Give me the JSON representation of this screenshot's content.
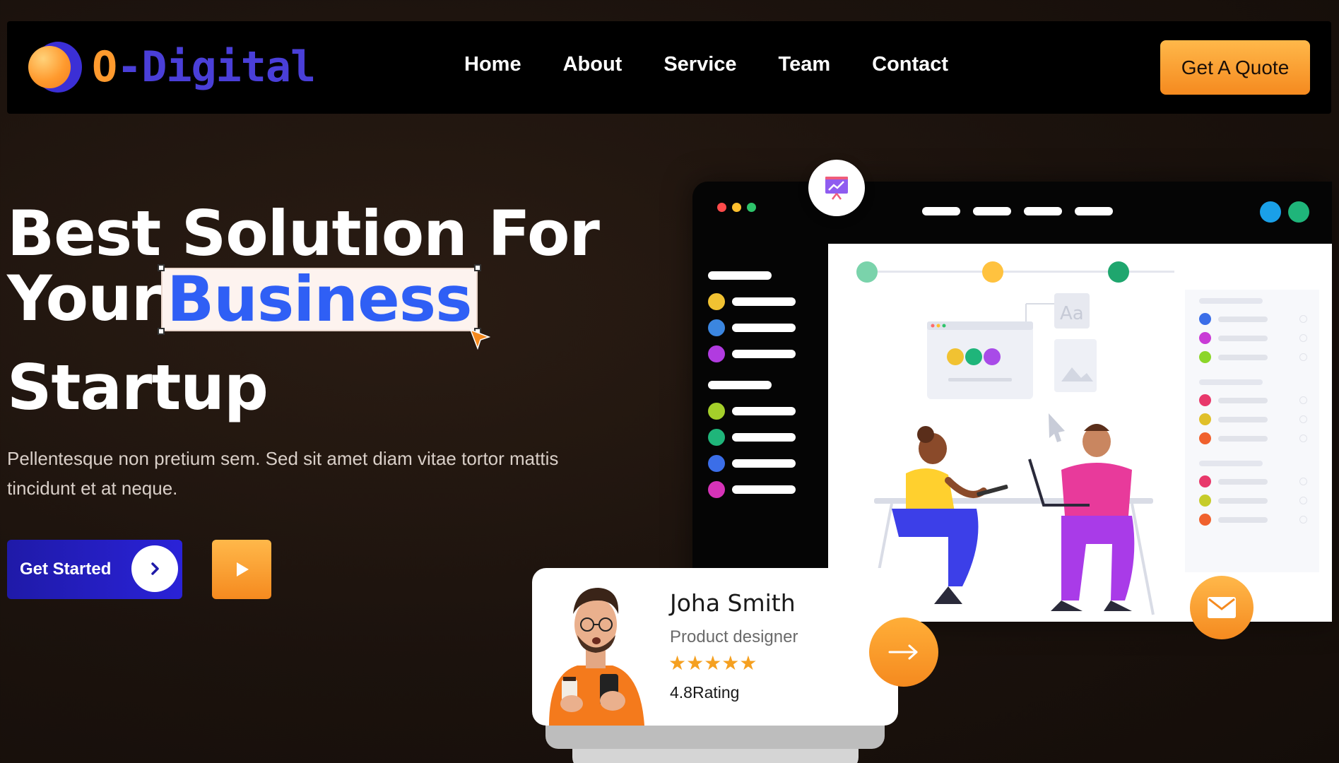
{
  "brand": {
    "logo_o": "O",
    "logo_rest": "-Digital"
  },
  "nav": {
    "items": [
      "Home",
      "About",
      "Service",
      "Team",
      "Contact"
    ],
    "cta_label": "Get A Quote"
  },
  "hero": {
    "title_line1": "Best Solution For",
    "title_line2_prefix": "Your",
    "title_highlight": "Business",
    "title_line3": "Startup",
    "subtitle": "Pellentesque non pretium sem. Sed sit amet diam vitae tortor mattis tincidunt et at neque.",
    "primary_button": "Get Started",
    "primary_button_icon": "chevron-right-icon",
    "secondary_button_icon": "play-icon"
  },
  "colors": {
    "accent_orange": "#f58a1f",
    "brand_blue": "#2a22d8",
    "highlight_text": "#2f5ff5",
    "background": "#1b120d"
  },
  "profile": {
    "name": "Joha Smith",
    "role": "Product designer",
    "stars": "★★★★★",
    "rating": "4.8Rating"
  },
  "icons": {
    "presentation": "presentation-icon",
    "mail": "mail-icon",
    "arrow": "arrow-right-icon"
  }
}
